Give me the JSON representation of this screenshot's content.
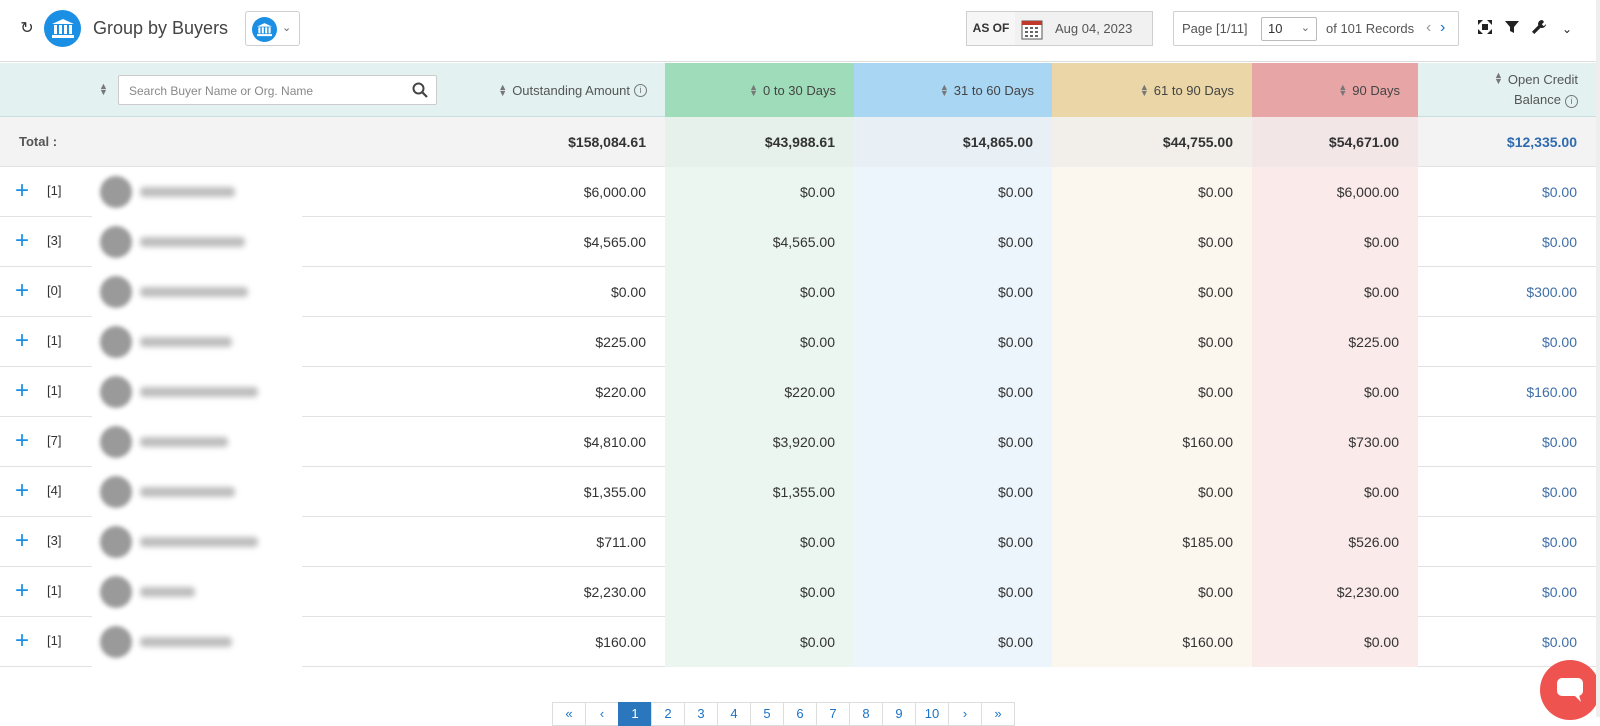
{
  "header": {
    "title": "Group by Buyers",
    "as_of_label": "AS OF",
    "date": "Aug 04, 2023",
    "page_label": "Page [1/11]",
    "page_size": "10",
    "records": "of 101 Records"
  },
  "icons": {
    "refresh": "refresh-icon",
    "bank": "bank-icon",
    "calendar": "calendar-icon",
    "expand": "expand-icon",
    "filter": "filter-icon",
    "settings": "wrench-icon",
    "more": "chevron-down-icon"
  },
  "colors": {
    "accent": "#1a8fe3",
    "c0_30_head": "#9fdcb9",
    "c31_60_head": "#a9d6f3",
    "c61_90_head": "#ead6a6",
    "c90_head": "#e8a5a5",
    "credit_link": "#3f6ea8"
  },
  "table": {
    "search_placeholder": "Search Buyer Name or Org. Name",
    "columns": {
      "outstanding": "Outstanding Amount",
      "d0_30": "0 to 30 Days",
      "d31_60": "31 to 60 Days",
      "d61_90": "61 to 90 Days",
      "d90": "90 Days",
      "credit_1": "Open Credit",
      "credit_2": "Balance"
    },
    "total": {
      "label": "Total :",
      "outstanding": "$158,084.61",
      "d0_30": "$43,988.61",
      "d31_60": "$14,865.00",
      "d61_90": "$44,755.00",
      "d90": "$54,671.00",
      "credit": "$12,335.00"
    },
    "rows": [
      {
        "count": "[1]",
        "outstanding": "$6,000.00",
        "d0_30": "$0.00",
        "d31_60": "$0.00",
        "d61_90": "$0.00",
        "d90": "$6,000.00",
        "credit": "$0.00"
      },
      {
        "count": "[3]",
        "outstanding": "$4,565.00",
        "d0_30": "$4,565.00",
        "d31_60": "$0.00",
        "d61_90": "$0.00",
        "d90": "$0.00",
        "credit": "$0.00"
      },
      {
        "count": "[0]",
        "outstanding": "$0.00",
        "d0_30": "$0.00",
        "d31_60": "$0.00",
        "d61_90": "$0.00",
        "d90": "$0.00",
        "credit": "$300.00"
      },
      {
        "count": "[1]",
        "outstanding": "$225.00",
        "d0_30": "$0.00",
        "d31_60": "$0.00",
        "d61_90": "$0.00",
        "d90": "$225.00",
        "credit": "$0.00"
      },
      {
        "count": "[1]",
        "outstanding": "$220.00",
        "d0_30": "$220.00",
        "d31_60": "$0.00",
        "d61_90": "$0.00",
        "d90": "$0.00",
        "credit": "$160.00"
      },
      {
        "count": "[7]",
        "outstanding": "$4,810.00",
        "d0_30": "$3,920.00",
        "d31_60": "$0.00",
        "d61_90": "$160.00",
        "d90": "$730.00",
        "credit": "$0.00"
      },
      {
        "count": "[4]",
        "outstanding": "$1,355.00",
        "d0_30": "$1,355.00",
        "d31_60": "$0.00",
        "d61_90": "$0.00",
        "d90": "$0.00",
        "credit": "$0.00"
      },
      {
        "count": "[3]",
        "outstanding": "$711.00",
        "d0_30": "$0.00",
        "d31_60": "$0.00",
        "d61_90": "$185.00",
        "d90": "$526.00",
        "credit": "$0.00"
      },
      {
        "count": "[1]",
        "outstanding": "$2,230.00",
        "d0_30": "$0.00",
        "d31_60": "$0.00",
        "d61_90": "$0.00",
        "d90": "$2,230.00",
        "credit": "$0.00"
      },
      {
        "count": "[1]",
        "outstanding": "$160.00",
        "d0_30": "$0.00",
        "d31_60": "$0.00",
        "d61_90": "$160.00",
        "d90": "$0.00",
        "credit": "$0.00"
      }
    ]
  },
  "pagination": {
    "first": "«",
    "prev": "‹",
    "pages": [
      "1",
      "2",
      "3",
      "4",
      "5",
      "6",
      "7",
      "8",
      "9",
      "10"
    ],
    "next": "›",
    "last": "»"
  }
}
